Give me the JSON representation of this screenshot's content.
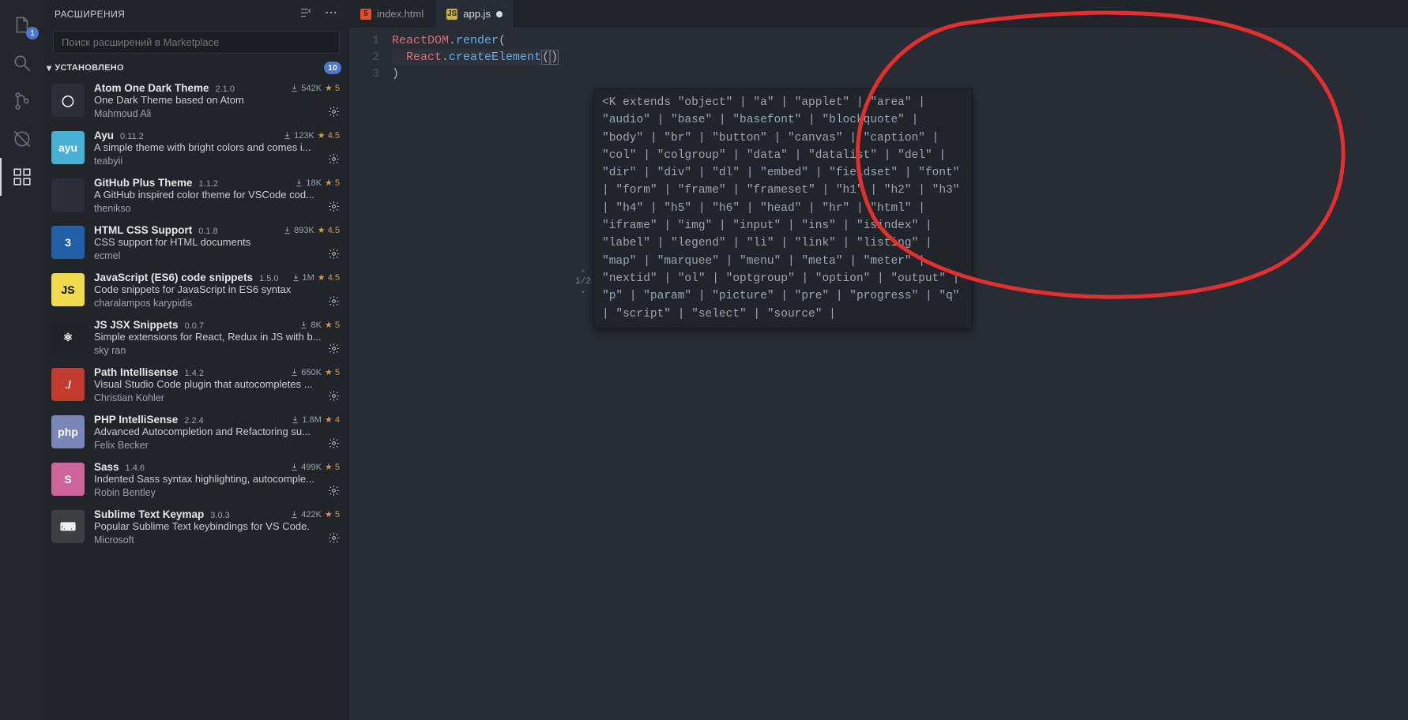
{
  "activity": {
    "explorer_badge": "1"
  },
  "sidebar": {
    "title": "РАСШИРЕНИЯ",
    "search_placeholder": "Поиск расширений в Marketplace",
    "installed_label": "УСТАНОВЛЕНО",
    "installed_count": "10"
  },
  "extensions": [
    {
      "name": "Atom One Dark Theme",
      "version": "2.1.0",
      "downloads": "542K",
      "rating": "5",
      "desc": "One Dark Theme based on Atom",
      "author": "Mahmoud Ali",
      "iconBg": "#2b2e36",
      "iconText": "◯"
    },
    {
      "name": "Ayu",
      "version": "0.11.2",
      "downloads": "123K",
      "rating": "4.5",
      "desc": "A simple theme with bright colors and comes i...",
      "author": "teabyii",
      "iconBg": "#48b0d3",
      "iconText": "ayu"
    },
    {
      "name": "GitHub Plus Theme",
      "version": "1.1.2",
      "downloads": "18K",
      "rating": "5",
      "desc": "A GitHub inspired color theme for VSCode cod...",
      "author": "thenikso",
      "iconBg": "#2b2e36",
      "iconText": ""
    },
    {
      "name": "HTML CSS Support",
      "version": "0.1.8",
      "downloads": "893K",
      "rating": "4.5",
      "desc": "CSS support for HTML documents",
      "author": "ecmel",
      "iconBg": "#2160a8",
      "iconText": "3"
    },
    {
      "name": "JavaScript (ES6) code snippets",
      "version": "1.5.0",
      "downloads": "1M",
      "rating": "4.5",
      "desc": "Code snippets for JavaScript in ES6 syntax",
      "author": "charalampos karypidis",
      "iconBg": "#f0db4f",
      "iconText": "JS"
    },
    {
      "name": "JS JSX Snippets",
      "version": "0.0.7",
      "downloads": "8K",
      "rating": "5",
      "desc": "Simple extensions for React, Redux in JS with b...",
      "author": "sky ran",
      "iconBg": "#20232a",
      "iconText": "⚛"
    },
    {
      "name": "Path Intellisense",
      "version": "1.4.2",
      "downloads": "650K",
      "rating": "5",
      "desc": "Visual Studio Code plugin that autocompletes ...",
      "author": "Christian Kohler",
      "iconBg": "#c33b2e",
      "iconText": "./"
    },
    {
      "name": "PHP IntelliSense",
      "version": "2.2.4",
      "downloads": "1.8M",
      "rating": "4",
      "desc": "Advanced Autocompletion and Refactoring su...",
      "author": "Felix Becker",
      "iconBg": "#7a86b8",
      "iconText": "php"
    },
    {
      "name": "Sass",
      "version": "1.4.6",
      "downloads": "499K",
      "rating": "5",
      "desc": "Indented Sass syntax highlighting, autocomple...",
      "author": "Robin Bentley",
      "iconBg": "#cf649a",
      "iconText": "S"
    },
    {
      "name": "Sublime Text Keymap",
      "version": "3.0.3",
      "downloads": "422K",
      "rating": "5",
      "desc": "Popular Sublime Text keybindings for VS Code.",
      "author": "Microsoft",
      "iconBg": "#3c3f41",
      "iconText": "⌨"
    }
  ],
  "tabs": [
    {
      "label": "index.html",
      "icon": "5",
      "iconColor": "#e44d26",
      "active": false,
      "dirty": false
    },
    {
      "label": "app.js",
      "icon": "JS",
      "iconColor": "#cbb33f",
      "active": true,
      "dirty": true
    }
  ],
  "code": {
    "lines": [
      "1",
      "2",
      "3"
    ],
    "l1_a": "ReactDOM",
    "l1_b": ".",
    "l1_c": "render",
    "l1_d": "(",
    "l2_a": "React",
    "l2_b": ".",
    "l2_c": "createElement",
    "l2_d": "(",
    "l2_e": ")",
    "l3_a": ")"
  },
  "hint": {
    "counter_top": "⌃",
    "counter_mid": "1/2",
    "counter_bot": "⌄",
    "text": "<K extends \"object\" | \"a\" | \"applet\" | \"area\" | \"audio\" | \"base\" | \"basefont\" | \"blockquote\" | \"body\" | \"br\" | \"button\" | \"canvas\" | \"caption\" | \"col\" | \"colgroup\" | \"data\" | \"datalist\" | \"del\" | \"dir\" | \"div\" | \"dl\" | \"embed\" | \"fieldset\" | \"font\" | \"form\" | \"frame\" | \"frameset\" | \"h1\" | \"h2\" | \"h3\" | \"h4\" | \"h5\" | \"h6\" | \"head\" | \"hr\" | \"html\" | \"iframe\" | \"img\" | \"input\" | \"ins\" | \"isindex\" | \"label\" | \"legend\" | \"li\" | \"link\" | \"listing\" | \"map\" | \"marquee\" | \"menu\" | \"meta\" | \"meter\" | \"nextid\" | \"ol\" | \"optgroup\" | \"option\" | \"output\" | \"p\" | \"param\" | \"picture\" | \"pre\" | \"progress\" | \"q\" | \"script\" | \"select\" | \"source\" |"
  }
}
